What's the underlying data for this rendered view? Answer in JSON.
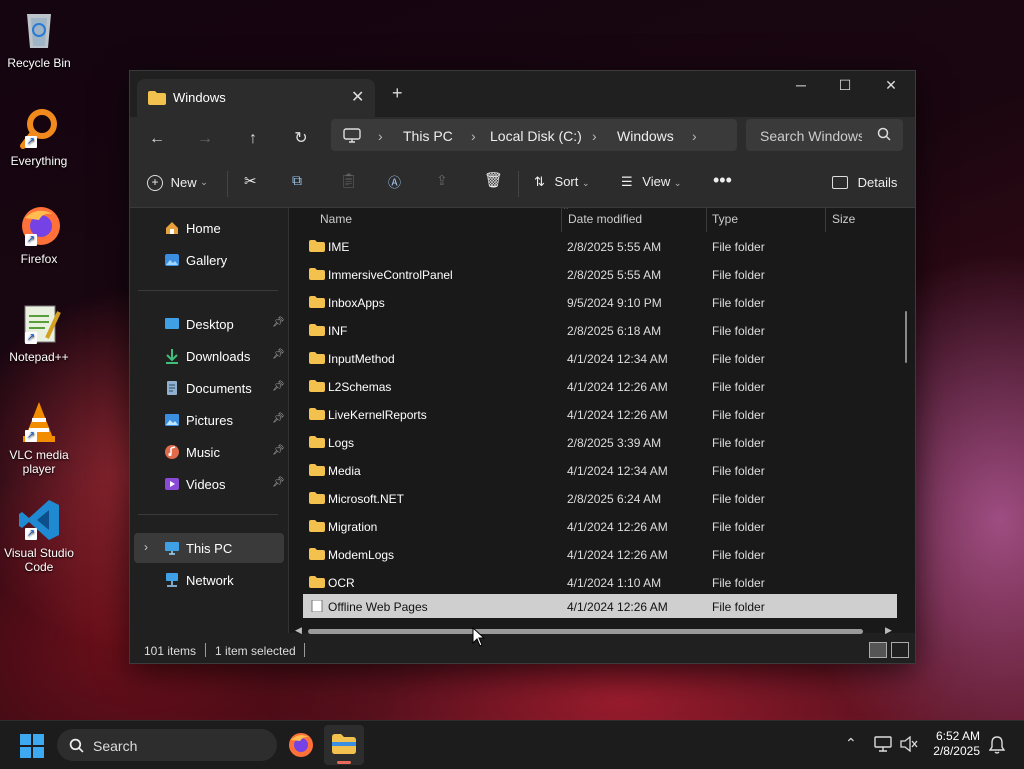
{
  "desktop": {
    "icons": [
      {
        "label": "Recycle Bin",
        "icon": "recycle-bin-icon"
      },
      {
        "label": "Everything",
        "icon": "everything-search-icon"
      },
      {
        "label": "Firefox",
        "icon": "firefox-icon"
      },
      {
        "label": "Notepad++",
        "icon": "notepad-plus-plus-icon"
      },
      {
        "label": "VLC media player",
        "icon": "vlc-icon"
      },
      {
        "label": "Visual Studio Code",
        "icon": "vscode-icon"
      }
    ]
  },
  "window": {
    "tab_title": "Windows",
    "address": {
      "segments": [
        "This PC",
        "Local Disk (C:)",
        "Windows"
      ]
    },
    "search_placeholder": "Search Windows",
    "toolbar": {
      "new_label": "New",
      "sort_label": "Sort",
      "view_label": "View",
      "details_label": "Details"
    },
    "sidebar": {
      "top": [
        {
          "label": "Home",
          "icon": "home-icon"
        },
        {
          "label": "Gallery",
          "icon": "gallery-icon"
        }
      ],
      "quick_access": [
        {
          "label": "Desktop",
          "icon": "desktop-folder-icon"
        },
        {
          "label": "Downloads",
          "icon": "downloads-icon"
        },
        {
          "label": "Documents",
          "icon": "documents-icon"
        },
        {
          "label": "Pictures",
          "icon": "pictures-icon"
        },
        {
          "label": "Music",
          "icon": "music-icon"
        },
        {
          "label": "Videos",
          "icon": "videos-icon"
        }
      ],
      "this_pc": "This PC",
      "network": "Network"
    },
    "columns": {
      "name": "Name",
      "date": "Date modified",
      "type": "Type",
      "size": "Size"
    },
    "files": [
      {
        "name": "IME",
        "date": "2/8/2025 5:55 AM",
        "type": "File folder"
      },
      {
        "name": "ImmersiveControlPanel",
        "date": "2/8/2025 5:55 AM",
        "type": "File folder"
      },
      {
        "name": "InboxApps",
        "date": "9/5/2024 9:10 PM",
        "type": "File folder"
      },
      {
        "name": "INF",
        "date": "2/8/2025 6:18 AM",
        "type": "File folder"
      },
      {
        "name": "InputMethod",
        "date": "4/1/2024 12:34 AM",
        "type": "File folder"
      },
      {
        "name": "L2Schemas",
        "date": "4/1/2024 12:26 AM",
        "type": "File folder"
      },
      {
        "name": "LiveKernelReports",
        "date": "4/1/2024 12:26 AM",
        "type": "File folder"
      },
      {
        "name": "Logs",
        "date": "2/8/2025 3:39 AM",
        "type": "File folder"
      },
      {
        "name": "Media",
        "date": "4/1/2024 12:34 AM",
        "type": "File folder"
      },
      {
        "name": "Microsoft.NET",
        "date": "2/8/2025 6:24 AM",
        "type": "File folder"
      },
      {
        "name": "Migration",
        "date": "4/1/2024 12:26 AM",
        "type": "File folder"
      },
      {
        "name": "ModemLogs",
        "date": "4/1/2024 12:26 AM",
        "type": "File folder"
      },
      {
        "name": "OCR",
        "date": "4/1/2024 1:10 AM",
        "type": "File folder"
      },
      {
        "name": "Offline Web Pages",
        "date": "4/1/2024 12:26 AM",
        "type": "File folder",
        "selected": true
      }
    ],
    "status": {
      "items": "101 items",
      "selected": "1 item selected"
    }
  },
  "taskbar": {
    "search_label": "Search",
    "time": "6:52 AM",
    "date": "2/8/2025"
  },
  "colors": {
    "folder": "#f2c14e",
    "window_bg": "#202020",
    "selected_row": "#cfcfcf"
  }
}
